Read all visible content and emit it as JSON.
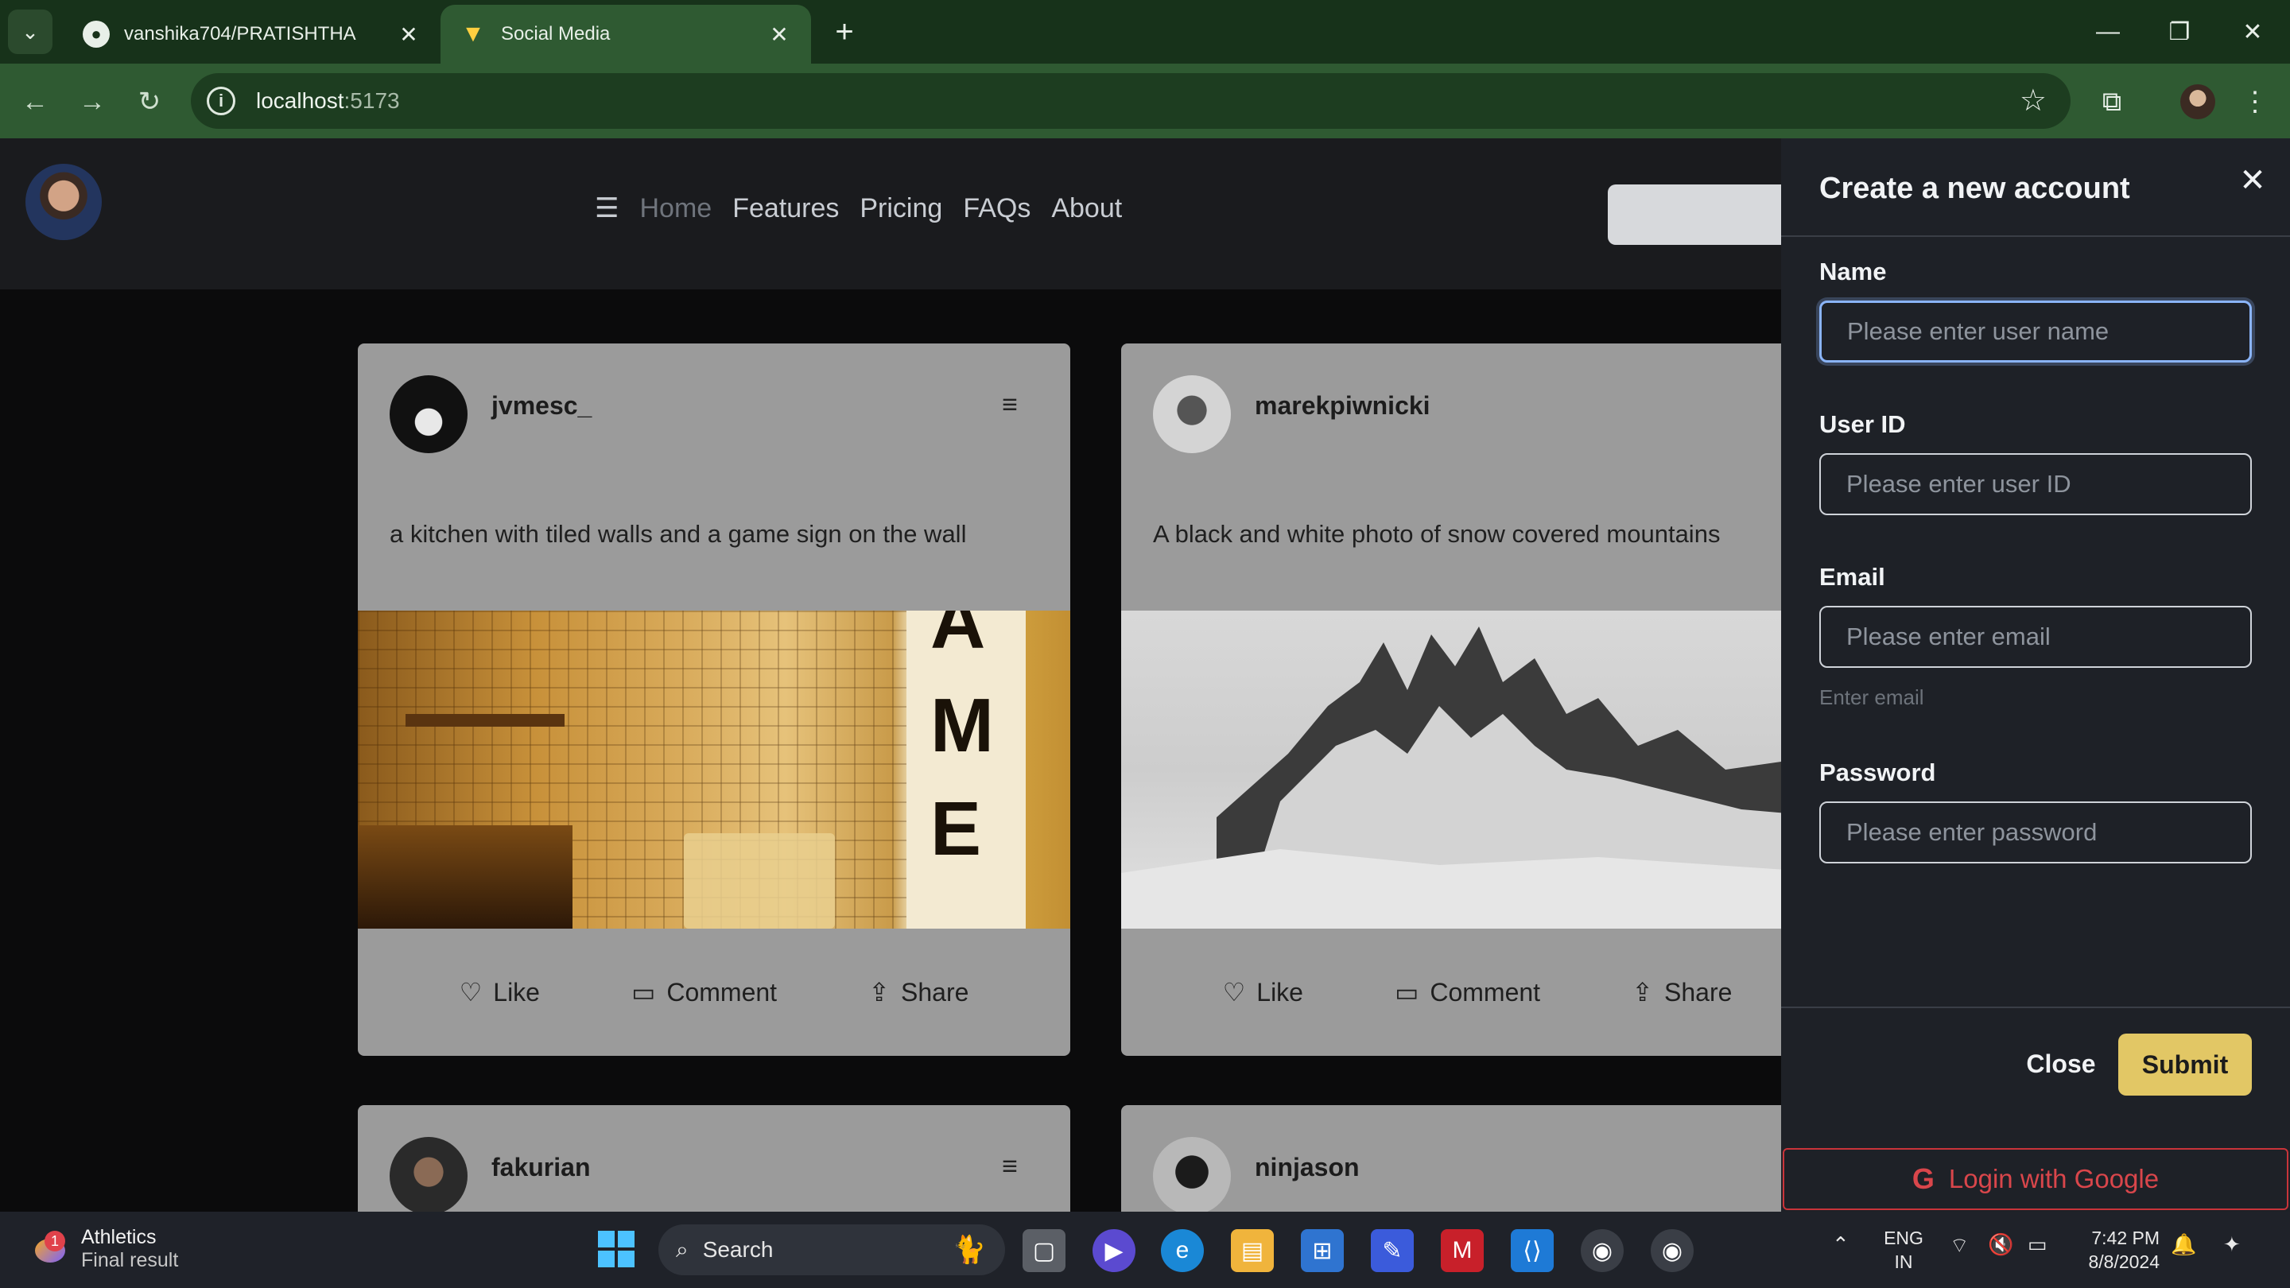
{
  "browser": {
    "tabs": [
      {
        "title": "vanshika704/PRATISHTHA",
        "active": false,
        "icon": "github-icon"
      },
      {
        "title": "Social Media",
        "active": true,
        "icon": "vite-icon"
      }
    ],
    "url_host": "localhost",
    "url_port": ":5173",
    "accent": "#2f5a32"
  },
  "site": {
    "nav": [
      "Home",
      "Features",
      "Pricing",
      "FAQs",
      "About"
    ]
  },
  "posts": [
    {
      "user": "jvmesc_",
      "caption": "a kitchen with tiled walls and a game sign on the wall",
      "sign_letters": [
        "A",
        "M",
        "E"
      ]
    },
    {
      "user": "marekpiwnicki",
      "caption": "A black and white photo of snow covered mountains"
    },
    {
      "user": "fakurian"
    },
    {
      "user": "ninjason"
    }
  ],
  "post_actions": {
    "like": "Like",
    "comment": "Comment",
    "share": "Share"
  },
  "modal": {
    "title": "Create a new account",
    "fields": [
      {
        "label": "Name",
        "placeholder": "Please enter user name"
      },
      {
        "label": "User ID",
        "placeholder": "Please enter user ID"
      },
      {
        "label": "Email",
        "placeholder": "Please enter email",
        "hint": "Enter email"
      },
      {
        "label": "Password",
        "placeholder": "Please enter password"
      }
    ],
    "close_label": "Close",
    "submit_label": "Submit",
    "google_label": "Login with Google",
    "submit_color": "#e2c765",
    "google_color": "#c9343a"
  },
  "taskbar": {
    "weather_title": "Athletics",
    "weather_sub": "Final result",
    "notification_count": "1",
    "search_placeholder": "Search",
    "lang": "ENG",
    "region": "IN",
    "time": "7:42 PM",
    "date": "8/8/2024"
  }
}
